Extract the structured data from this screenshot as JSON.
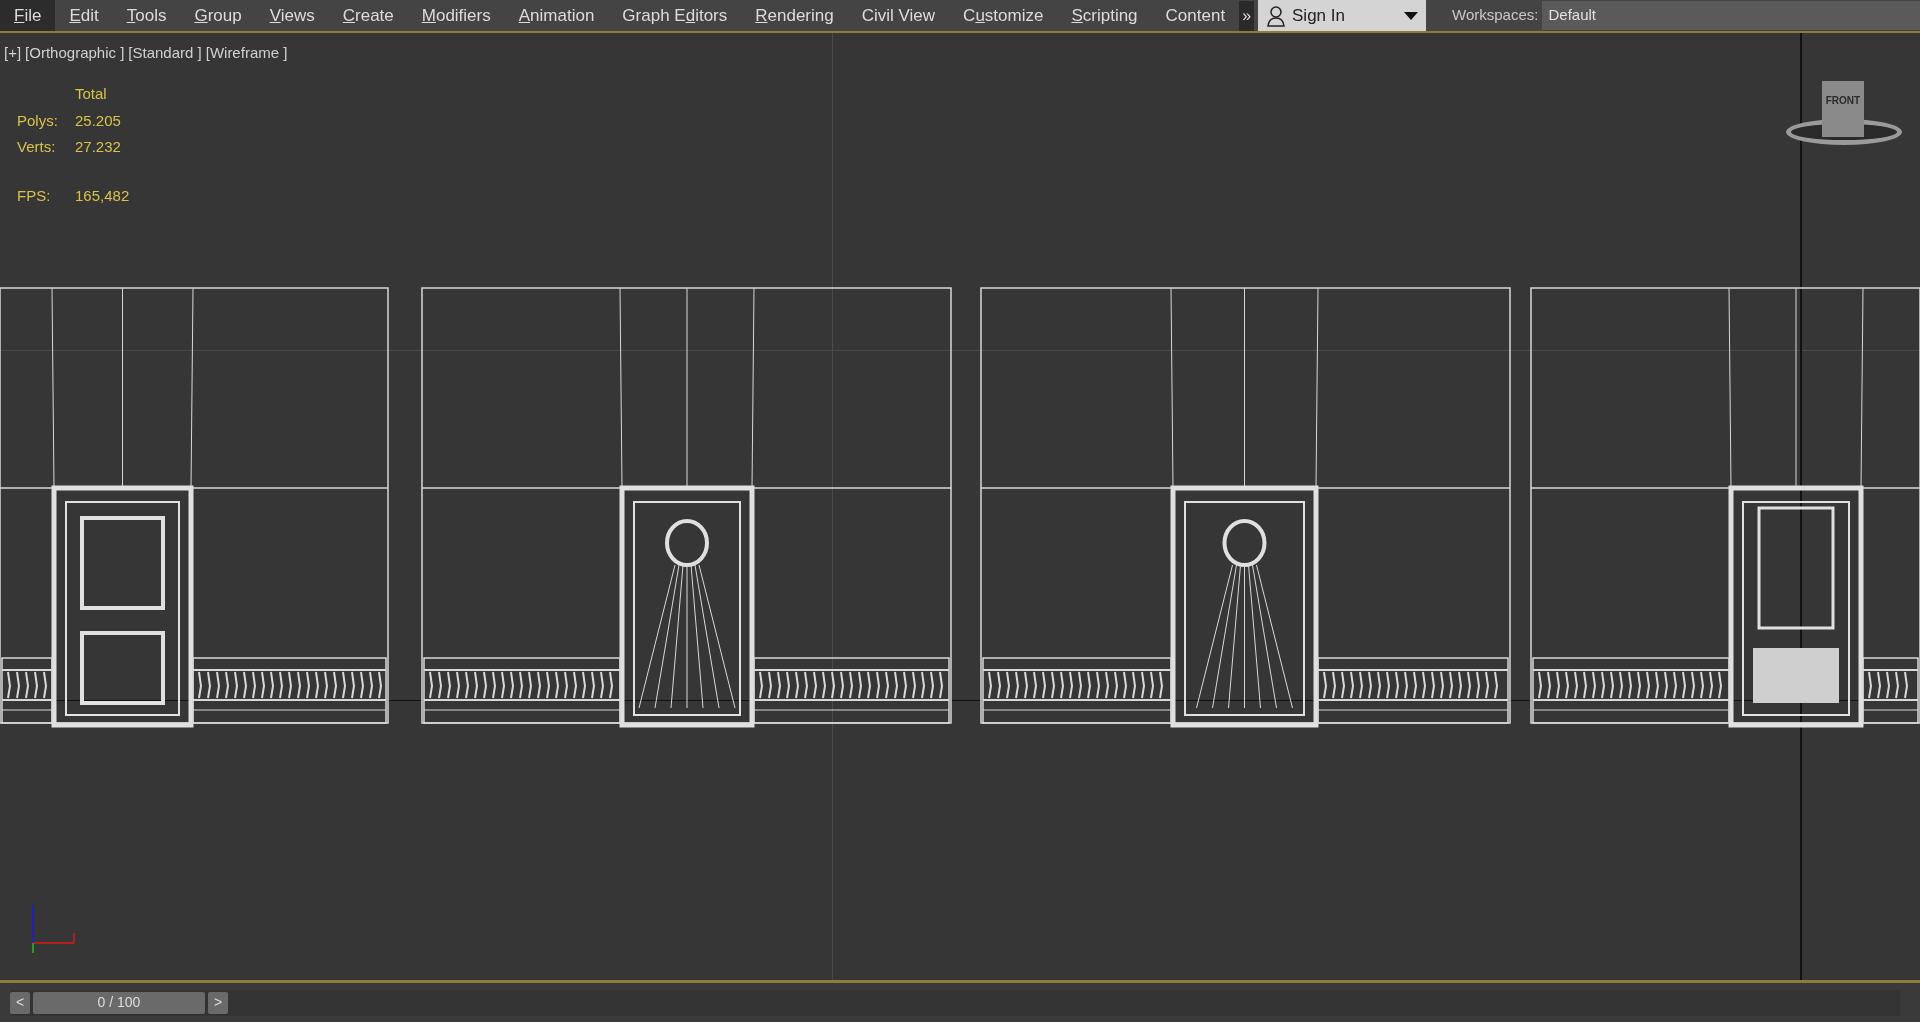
{
  "menu": [
    {
      "key": "F",
      "post": "ile",
      "selected": true
    },
    {
      "key": "E",
      "post": "dit",
      "selected": false
    },
    {
      "key": "T",
      "post": "ools",
      "selected": false
    },
    {
      "key": "G",
      "post": "roup",
      "selected": false
    },
    {
      "key": "V",
      "post": "iews",
      "selected": false
    },
    {
      "key": "C",
      "post": "reate",
      "selected": false
    },
    {
      "key": "M",
      "post": "odifiers",
      "selected": false
    },
    {
      "key": "A",
      "post": "nimation",
      "selected": false
    },
    {
      "pre": "Graph E",
      "key": "d",
      "post": "itors",
      "selected": false
    },
    {
      "key": "R",
      "post": "endering",
      "selected": false
    },
    {
      "pre": "Civil View",
      "selected": false
    },
    {
      "pre": "C",
      "key": "u",
      "post": "stomize",
      "selected": false
    },
    {
      "key": "S",
      "post": "cripting",
      "selected": false
    },
    {
      "pre": "Content",
      "selected": false
    }
  ],
  "overflow": "»",
  "sign_in": {
    "label": "Sign In"
  },
  "workspaces": {
    "label": "Workspaces:",
    "value": "Default"
  },
  "viewport": {
    "labels": [
      "[+]",
      "[Orthographic ]",
      "[Standard ]",
      "[Wireframe ]"
    ],
    "stats": {
      "header": "Total",
      "rows": [
        {
          "label": "Polys:",
          "value": "25.205"
        },
        {
          "label": "Verts:",
          "value": "27.232"
        }
      ],
      "fps_label": "FPS:",
      "fps": "165,482"
    },
    "viewcube": {
      "face": "FRONT"
    }
  },
  "timeline": {
    "prev": "<",
    "frame": "0 / 100",
    "level": 0,
    "next": ">"
  }
}
